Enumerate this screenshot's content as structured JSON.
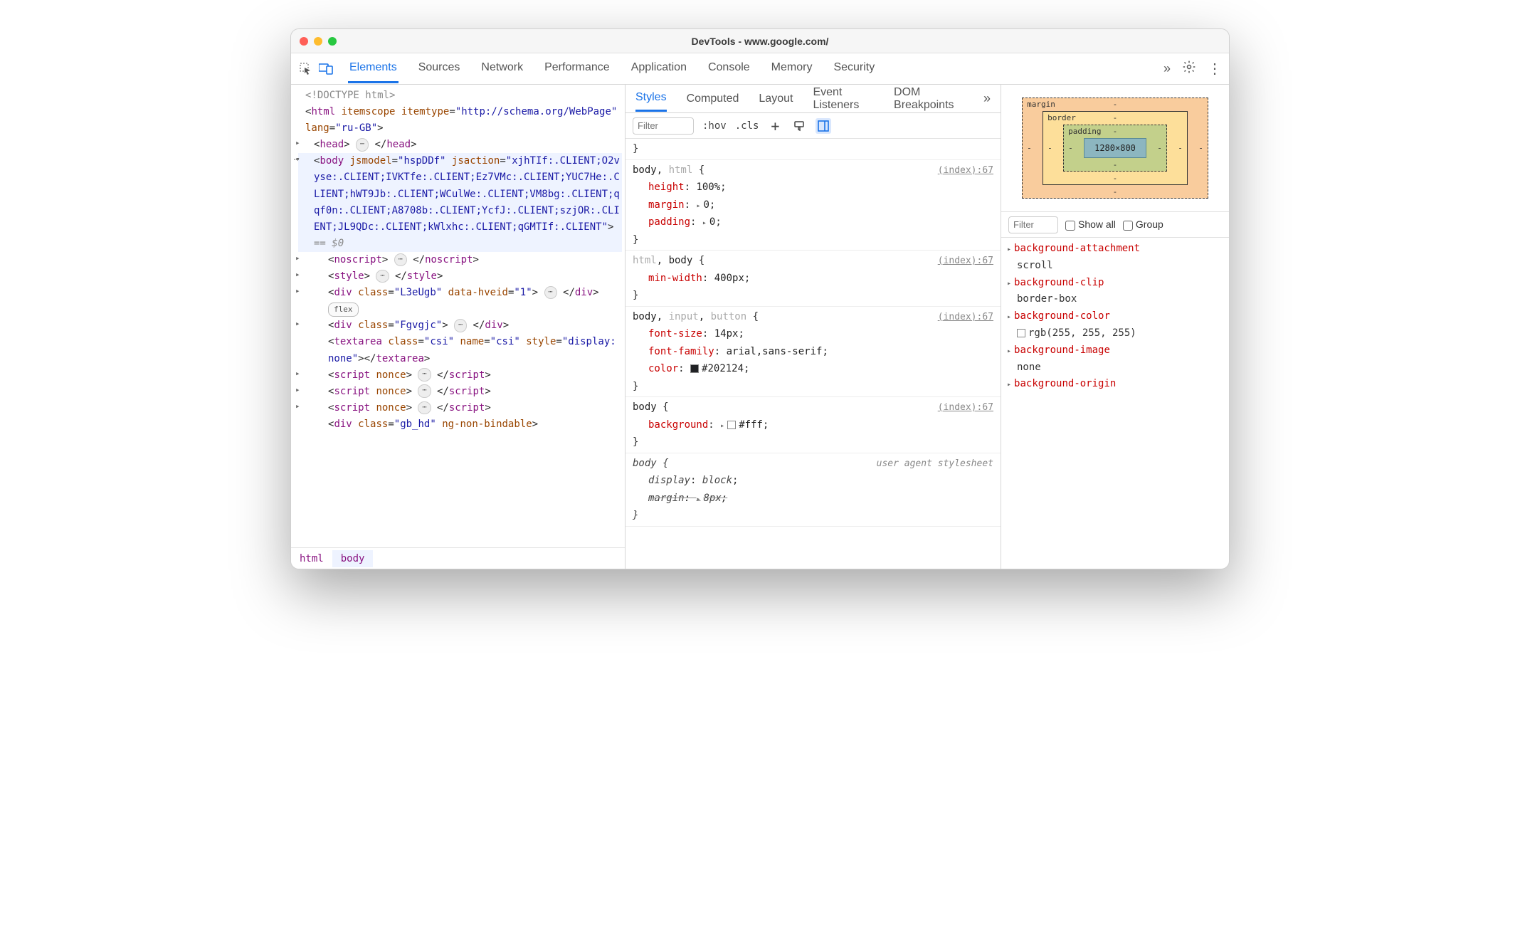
{
  "window_title": "DevTools - www.google.com/",
  "main_tabs": [
    "Elements",
    "Sources",
    "Network",
    "Performance",
    "Application",
    "Console",
    "Memory",
    "Security"
  ],
  "main_active_tab": "Elements",
  "sub_tabs": [
    "Styles",
    "Computed",
    "Layout",
    "Event Listeners",
    "DOM Breakpoints"
  ],
  "sub_active_tab": "Styles",
  "breadcrumbs": [
    "html",
    "body"
  ],
  "dom": {
    "doctype": "<!DOCTYPE html>",
    "html_open": {
      "tag": "html",
      "attrs": "itemscope itemtype=\"http://schema.org/WebPage\" lang=\"ru-GB\""
    },
    "head": {
      "tag": "head"
    },
    "body_open": {
      "tag": "body",
      "attrs": "jsmodel=\"hspDDf\" jsaction=\"xjhTIf:.CLIENT;O2vyse:.CLIENT;IVKTfe:.CLIENT;Ez7VMc:.CLIENT;YUC7He:.CLIENT;hWT9Jb:.CLIENT;WCulWe:.CLIENT;VM8bg:.CLIENT;qqf0n:.CLIENT;A8708b:.CLIENT;YcfJ:.CLIENT;szjOR:.CLIENT;JL9QDc:.CLIENT;kWlxhc:.CLIENT;qGMTIf:.CLIENT\"",
      "trailer": "== $0"
    },
    "children": [
      {
        "type": "collapsed",
        "tag": "noscript"
      },
      {
        "type": "collapsed",
        "tag": "style"
      },
      {
        "type": "div_flex",
        "tag": "div",
        "attrs": "class=\"L3eUgb\" data-hveid=\"1\"",
        "badge": "flex"
      },
      {
        "type": "div_empty",
        "tag": "div",
        "attrs": "class=\"Fgvgjc\""
      },
      {
        "type": "textarea",
        "tag": "textarea",
        "attrs": "class=\"csi\" name=\"csi\" style=\"display:none\""
      },
      {
        "type": "script",
        "tag": "script",
        "attrs": "nonce"
      },
      {
        "type": "script",
        "tag": "script",
        "attrs": "nonce"
      },
      {
        "type": "script",
        "tag": "script",
        "attrs": "nonce"
      },
      {
        "type": "plain",
        "raw": "<div class=\"gb_hd\" ng-non-bindable>"
      }
    ]
  },
  "styles_filter_placeholder": "Filter",
  "style_buttons": {
    "hov": ":hov",
    "cls": ".cls"
  },
  "rules": [
    {
      "brace_only_close": true
    },
    {
      "selector_parts": [
        {
          "t": "body",
          "dim": false
        },
        {
          "t": ", ",
          "dim": false
        },
        {
          "t": "html",
          "dim": true
        }
      ],
      "source": "(index):67",
      "decls": [
        {
          "name": "height",
          "value": "100%"
        },
        {
          "name": "margin",
          "value": "0",
          "tri": true
        },
        {
          "name": "padding",
          "value": "0",
          "tri": true
        }
      ]
    },
    {
      "selector_parts": [
        {
          "t": "html",
          "dim": true
        },
        {
          "t": ", ",
          "dim": false
        },
        {
          "t": "body",
          "dim": false
        }
      ],
      "source": "(index):67",
      "decls": [
        {
          "name": "min-width",
          "value": "400px"
        }
      ]
    },
    {
      "selector_parts": [
        {
          "t": "body",
          "dim": false
        },
        {
          "t": ", ",
          "dim": false
        },
        {
          "t": "input",
          "dim": true
        },
        {
          "t": ", ",
          "dim": false
        },
        {
          "t": "button",
          "dim": true
        }
      ],
      "source": "(index):67",
      "decls": [
        {
          "name": "font-size",
          "value": "14px"
        },
        {
          "name": "font-family",
          "value": "arial,sans-serif"
        },
        {
          "name": "color",
          "value": "#202124",
          "swatch": "#202124"
        }
      ]
    },
    {
      "selector_parts": [
        {
          "t": "body",
          "dim": false
        }
      ],
      "source": "(index):67",
      "decls": [
        {
          "name": "background",
          "value": "#fff",
          "tri": true,
          "swatch": "#ffffff"
        }
      ]
    },
    {
      "selector_parts": [
        {
          "t": "body",
          "dim": false
        }
      ],
      "source_ua": "user agent stylesheet",
      "ua": true,
      "decls": [
        {
          "name": "display",
          "value": "block"
        },
        {
          "name": "margin",
          "value": "8px",
          "strike": true,
          "tri": true
        }
      ]
    }
  ],
  "boxmodel": {
    "margin": {
      "label": "margin",
      "top": "-",
      "right": "-",
      "bottom": "-",
      "left": "-"
    },
    "border": {
      "label": "border",
      "top": "-",
      "right": "-",
      "bottom": "-",
      "left": "-"
    },
    "padding": {
      "label": "padding",
      "top": "-",
      "right": "-",
      "bottom": "-",
      "left": "-"
    },
    "content": "1280×800"
  },
  "computed_filter_placeholder": "Filter",
  "computed_checkbox_labels": {
    "show_all": "Show all",
    "group": "Group"
  },
  "computed": [
    {
      "name": "background-attachment",
      "value": "scroll"
    },
    {
      "name": "background-clip",
      "value": "border-box"
    },
    {
      "name": "background-color",
      "value": "rgb(255, 255, 255)",
      "swatch": "#ffffff"
    },
    {
      "name": "background-image",
      "value": "none"
    },
    {
      "name": "background-origin",
      "value": ""
    }
  ]
}
